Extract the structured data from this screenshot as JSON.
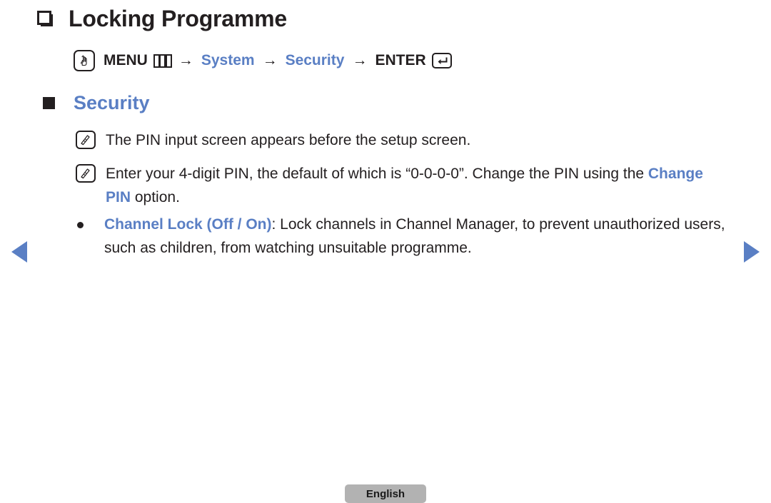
{
  "page": {
    "title": "Locking Programme",
    "language_button": "English"
  },
  "menu_path": {
    "remote_icon": "hand-press-icon",
    "menu_label": "MENU",
    "menu_icon": "menu-grid-icon",
    "arrow": "→",
    "step_system": "System",
    "step_security": "Security",
    "enter_label": "ENTER",
    "enter_icon": "enter-key-icon"
  },
  "section": {
    "heading": "Security"
  },
  "notes": [
    {
      "icon": "note-icon",
      "text": "The PIN input screen appears before the setup screen."
    },
    {
      "icon": "note-icon",
      "text_before": "Enter your 4-digit PIN, the default of which is “0-0-0-0”. Change the PIN using the ",
      "highlight": "Change PIN",
      "text_after": " option."
    }
  ],
  "options": [
    {
      "bullet": "dot",
      "label": "Channel Lock (Off / On)",
      "description": ": Lock channels in Channel Manager, to prevent unauthorized users, such as children, from watching unsuitable programme."
    }
  ],
  "navigation": {
    "prev": "previous-page-arrow",
    "next": "next-page-arrow"
  },
  "colors": {
    "accent_blue": "#5a7fc4",
    "text_dark": "#231f20",
    "button_gray": "#b2b2b2"
  }
}
